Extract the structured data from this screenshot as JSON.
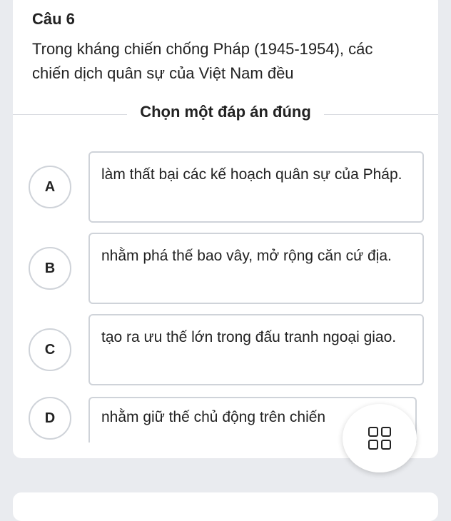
{
  "question": {
    "number": "Câu 6",
    "text": "Trong kháng chiến chống Pháp (1945-1954), các chiến dịch quân sự của Việt Nam đều"
  },
  "instruction": "Chọn một đáp án đúng",
  "options": [
    {
      "letter": "A",
      "text": "làm thất bại các kế hoạch quân sự của Pháp."
    },
    {
      "letter": "B",
      "text": "nhằm phá thế bao vây, mở rộng căn cứ địa."
    },
    {
      "letter": "C",
      "text": "tạo ra ưu thế lớn trong đấu tranh ngoại giao."
    },
    {
      "letter": "D",
      "text": "nhằm giữ thế chủ động trên chiến"
    }
  ],
  "fab_icon": "grid-icon"
}
